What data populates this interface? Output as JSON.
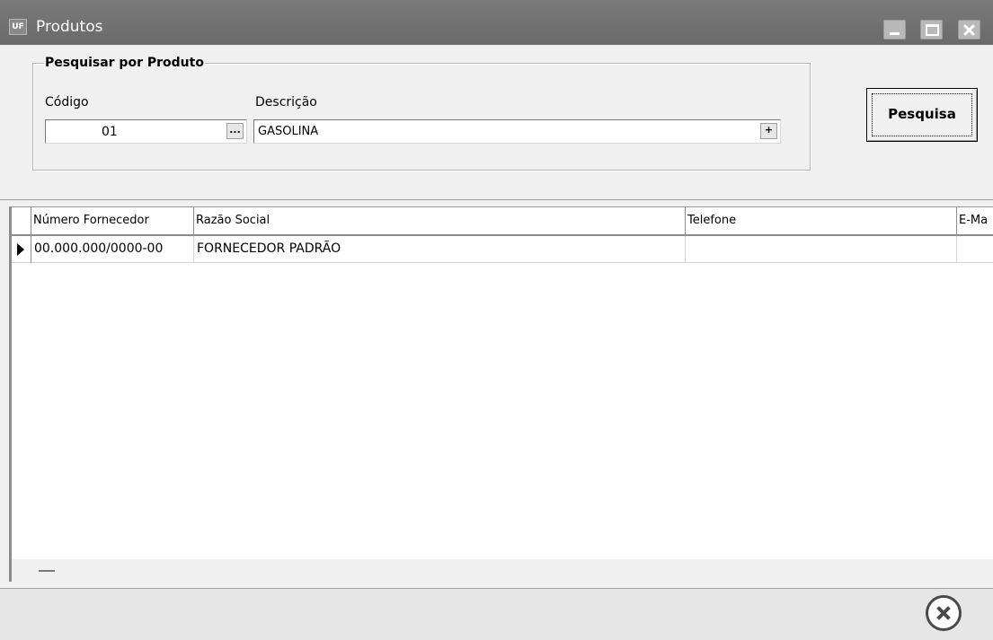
{
  "window": {
    "title": "Produtos",
    "icon_text": "UF"
  },
  "search_group": {
    "legend": "Pesquisar por Produto",
    "codigo_label": "Código",
    "codigo_value": "01",
    "codigo_button": "...",
    "descricao_label": "Descrição",
    "descricao_value": "GASOLINA",
    "descricao_button": "+"
  },
  "toolbar": {
    "search_label": "Pesquisa"
  },
  "grid": {
    "columns": [
      "Número Fornecedor",
      "Razão Social",
      "Telefone",
      "E-Ma"
    ],
    "rows": [
      {
        "numero_fornecedor": "00.000.000/0000-00",
        "razao_social": "FORNECEDOR PADRÃO",
        "telefone": "",
        "email": ""
      }
    ]
  },
  "icons": {
    "window_icon": "app-icon",
    "minimize": "minimize-icon",
    "maximize": "maximize-icon",
    "close": "close-icon",
    "row_indicator": "current-row-arrow-icon",
    "exit": "close-circle-icon"
  }
}
